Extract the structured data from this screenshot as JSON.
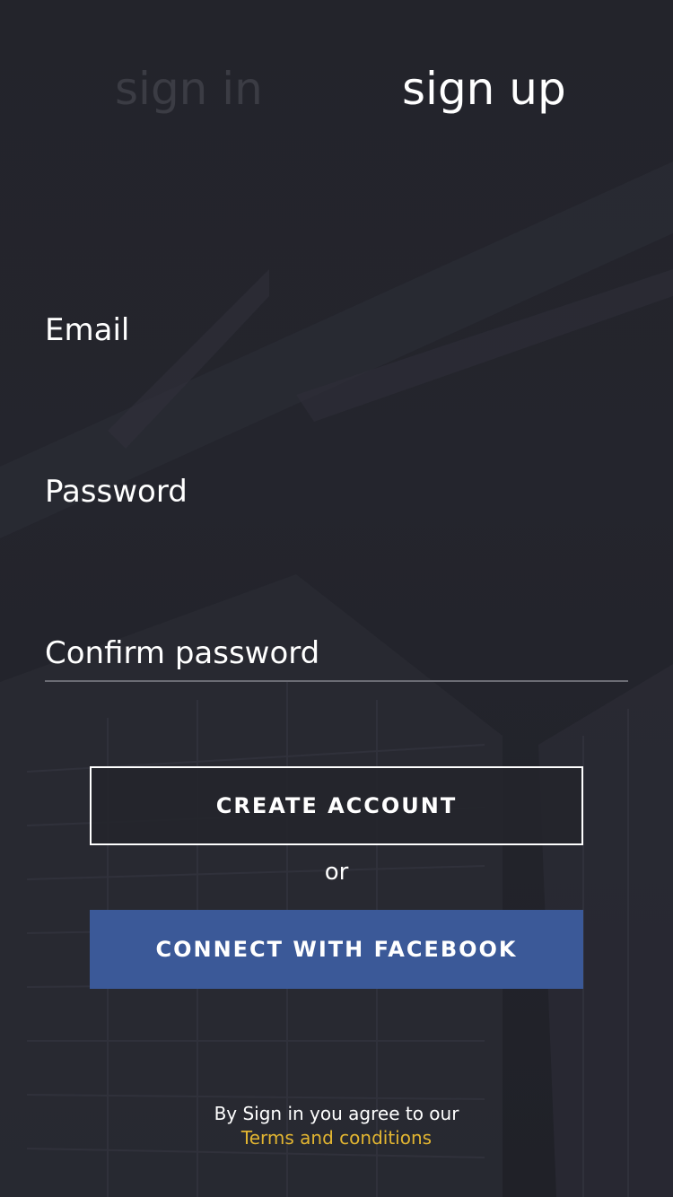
{
  "tabs": {
    "signin_label": "sign in",
    "signup_label": "sign up"
  },
  "form": {
    "email_placeholder": "Email",
    "password_placeholder": "Password",
    "confirm_placeholder": "Confirm password"
  },
  "buttons": {
    "create_account": "CREATE ACCOUNT",
    "or": "or",
    "facebook": "CONNECT WITH FACEBOOK"
  },
  "footer": {
    "agree_text": "By Sign in you agree to our",
    "terms_link": "Terms and conditions"
  },
  "colors": {
    "background": "#24252d",
    "facebook_blue": "#3b5998",
    "terms_yellow": "#e2b531",
    "inactive_tab": "#3b3c44"
  }
}
